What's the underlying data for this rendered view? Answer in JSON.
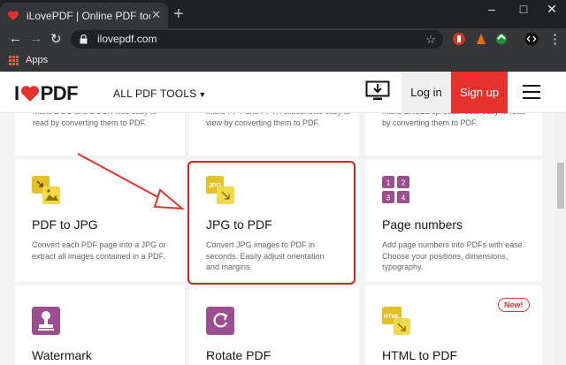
{
  "browser": {
    "tab_title": "iLovePDF | Online PDF tools for P",
    "url": "ilovepdf.com",
    "bookmarks_apps": "Apps"
  },
  "header": {
    "logo_left": "I",
    "logo_right": "PDF",
    "tools_label": "ALL PDF TOOLS",
    "login": "Log in",
    "signup": "Sign up"
  },
  "top_row": [
    {
      "desc": "Make DOC and DOCX files easy to read by converting them to PDF."
    },
    {
      "desc": "Make PPT and PPTX slideshows easy to view by converting them to PDF."
    },
    {
      "desc": "Make EXCEL spreadsheets easy to read by converting them to PDF."
    }
  ],
  "tools": [
    {
      "name": "PDF to JPG",
      "desc": "Convert each PDF page into a JPG or extract all images contained in a PDF."
    },
    {
      "name": "JPG to PDF",
      "desc": "Convert JPG images to PDF in seconds. Easily adjust orientation and margins.",
      "icon_text": "JPG"
    },
    {
      "name": "Page numbers",
      "desc": "Add page numbers into PDFs with ease. Choose your positions, dimensions, typography.",
      "digits": [
        "1",
        "2",
        "3",
        "4"
      ]
    },
    {
      "name": "Watermark"
    },
    {
      "name": "Rotate PDF"
    },
    {
      "name": "HTML to PDF",
      "icon_text": "HTML",
      "badge": "New!"
    }
  ],
  "colors": {
    "brand_red": "#e5322d",
    "jpg_yellow": "#e6c027",
    "purple": "#9b4f8e"
  }
}
